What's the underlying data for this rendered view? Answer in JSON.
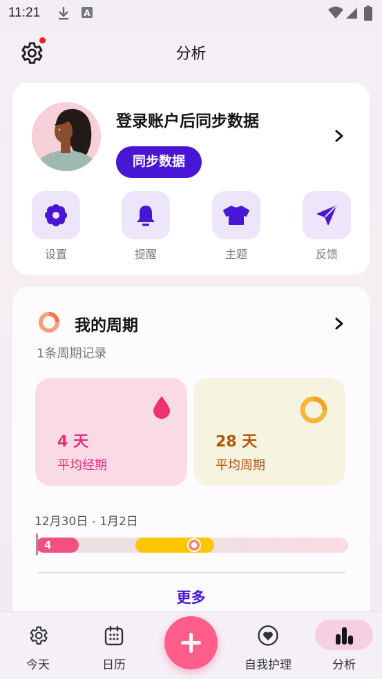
{
  "status_bar": {
    "time": "11:21",
    "icons": [
      "download-icon",
      "a-icon",
      "wifi-icon",
      "signal-icon",
      "battery-icon"
    ]
  },
  "header": {
    "title": "分析",
    "settings_icon": "gear-icon",
    "notification_dot_color": "#ff1f1f"
  },
  "profile": {
    "sync_title": "登录账户后同步数据",
    "sync_button": "同步数据",
    "quick_actions": [
      {
        "label": "设置",
        "icon": "flower-gear-icon"
      },
      {
        "label": "提醒",
        "icon": "bell-icon"
      },
      {
        "label": "主题",
        "icon": "shirt-icon"
      },
      {
        "label": "反馈",
        "icon": "send-icon"
      }
    ]
  },
  "cycle": {
    "title": "我的周期",
    "record_count": "1条周期记录",
    "period": {
      "value": "4 天",
      "label": "平均经期"
    },
    "cycle_length": {
      "value": "28 天",
      "label": "平均周期"
    },
    "date_range": "12月30日 - 1月2日",
    "timeline_period_days": "4",
    "more": "更多"
  },
  "bottom_nav": {
    "items": [
      {
        "label": "今天",
        "icon": "gear-icon"
      },
      {
        "label": "日历",
        "icon": "calendar-icon"
      },
      {
        "label": "自我护理",
        "icon": "heart-icon"
      },
      {
        "label": "分析",
        "icon": "bar-chart-icon",
        "active": true
      }
    ],
    "fab_icon": "plus-icon"
  },
  "colors": {
    "accent": "#4a16d6",
    "pink": "#ff5d8a",
    "period_text": "#ea2f79",
    "cycle_text": "#b25405",
    "fertile": "#fec600"
  }
}
